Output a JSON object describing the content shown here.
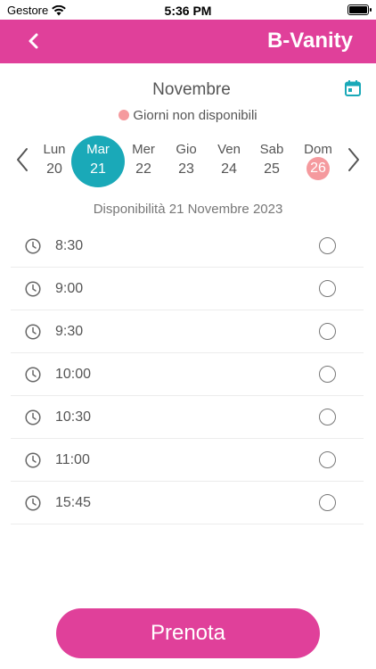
{
  "status": {
    "carrier": "Gestore",
    "time": "5:36 PM"
  },
  "nav": {
    "title": "B-Vanity"
  },
  "calendar": {
    "month": "Novembre",
    "legend": "Giorni non disponibili",
    "days": [
      {
        "name": "Lun",
        "num": "20"
      },
      {
        "name": "Mar",
        "num": "21"
      },
      {
        "name": "Mer",
        "num": "22"
      },
      {
        "name": "Gio",
        "num": "23"
      },
      {
        "name": "Ven",
        "num": "24"
      },
      {
        "name": "Sab",
        "num": "25"
      },
      {
        "name": "Dom",
        "num": "26"
      }
    ],
    "selected_day": "21",
    "unavailable_day": "26"
  },
  "availability_label": "Disponibilità 21 Novembre 2023",
  "slots": [
    "8:30",
    "9:00",
    "9:30",
    "10:00",
    "10:30",
    "11:00",
    "15:45"
  ],
  "book_button": "Prenota",
  "colors": {
    "brand": "#e0409a",
    "selected": "#1aa9b8",
    "unavailable": "#f59a9e"
  }
}
